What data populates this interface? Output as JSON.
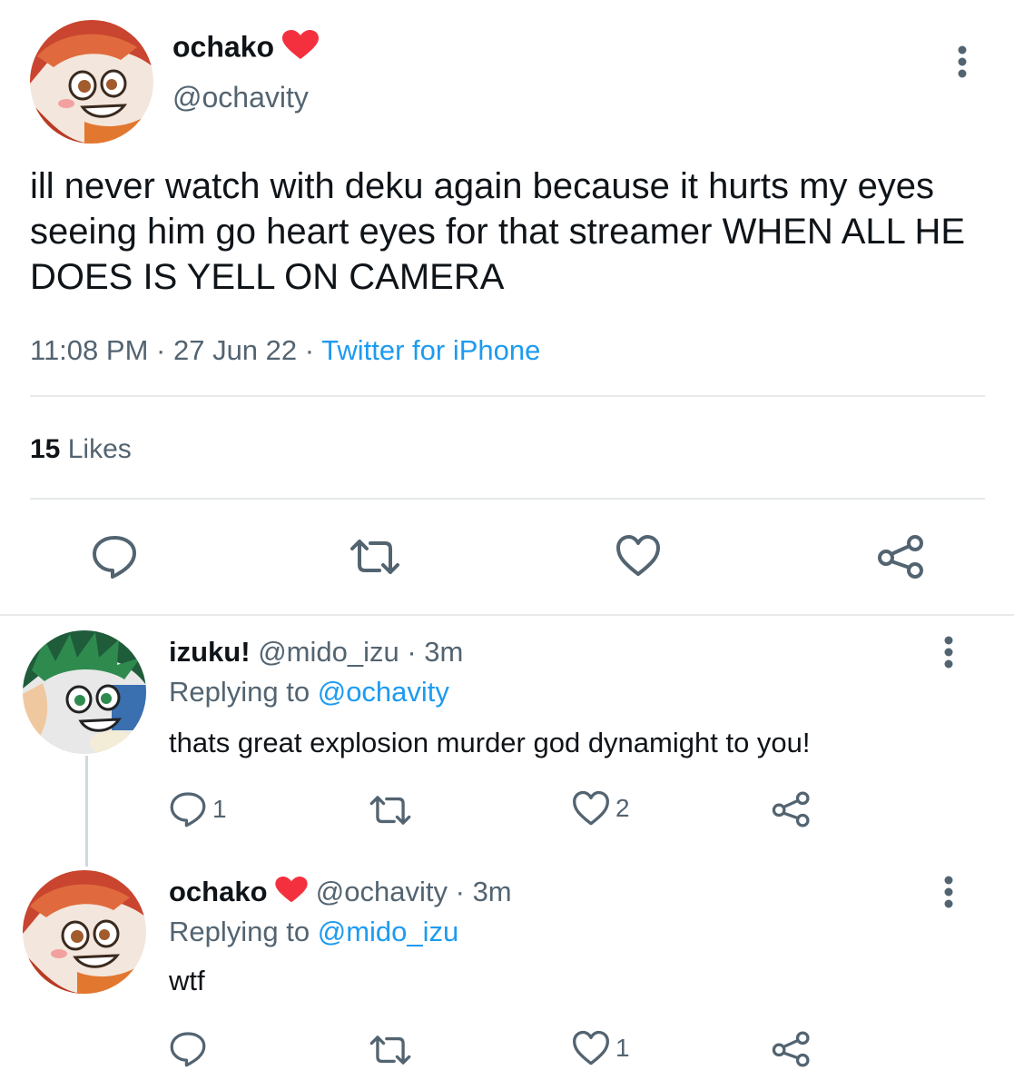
{
  "main_tweet": {
    "display_name": "ochako",
    "handle": "@ochavity",
    "text": "ill never watch with deku again because it hurts my eyes seeing him go heart eyes for that streamer WHEN ALL HE DOES IS YELL ON CAMERA",
    "time": "11:08 PM",
    "date": "27 Jun 22",
    "source": "Twitter for iPhone",
    "separator": "·",
    "likes_count": "15",
    "likes_label": "Likes",
    "badge_icon": "red-heart-icon"
  },
  "replies": [
    {
      "display_name": "izuku!",
      "handle": "@mido_izu",
      "age": "3m",
      "replying_label": "Replying to",
      "replying_to": "@ochavity",
      "text": "thats great explosion murder god dynamight to you!",
      "reply_count": "1",
      "like_count": "2"
    },
    {
      "display_name": "ochako",
      "handle": "@ochavity",
      "age": "3m",
      "replying_label": "Replying to",
      "replying_to": "@mido_izu",
      "text": "wtf",
      "reply_count": "",
      "like_count": "1"
    }
  ],
  "colors": {
    "text": "#0f1419",
    "secondary": "#536471",
    "link": "#1d9bf0",
    "divider": "#e7e9ea",
    "heart": "#f4303f"
  }
}
